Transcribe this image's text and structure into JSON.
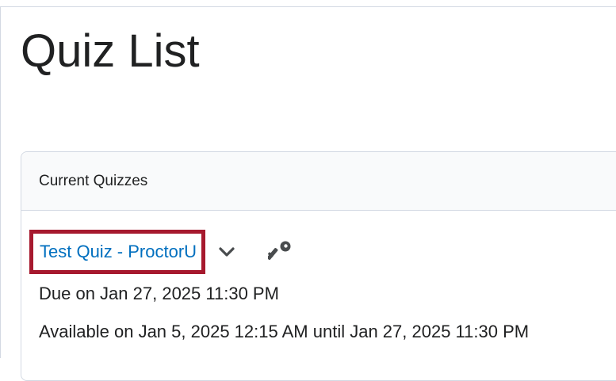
{
  "page": {
    "title": "Quiz List"
  },
  "panel": {
    "header_label": "Current Quizzes"
  },
  "quiz": {
    "name": "Test Quiz - ProctorU",
    "due": "Due on Jan 27, 2025 11:30 PM",
    "availability": "Available on Jan 5, 2025 12:15 AM until Jan 27, 2025 11:30 PM",
    "highlight_color": "#a6192e",
    "link_color": "#006fbf"
  },
  "icons": {
    "actions_menu": "chevron-down-icon",
    "restrictions": "key-icon"
  }
}
